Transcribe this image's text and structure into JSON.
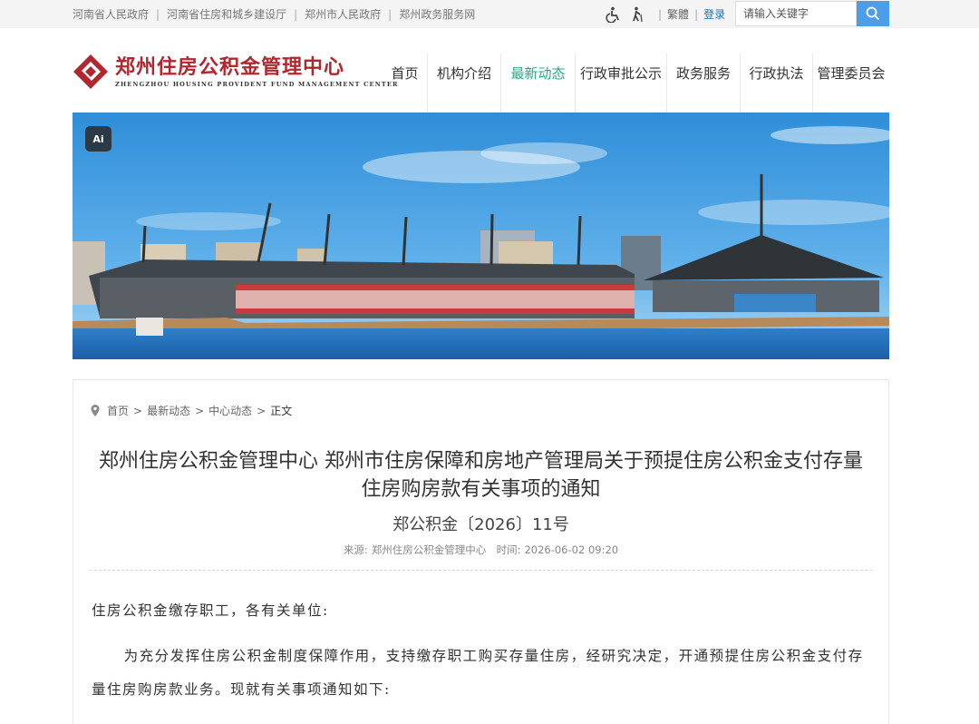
{
  "topbar": {
    "gov_links": [
      "河南省人民政府",
      "河南省住房和城乡建设厅",
      "郑州市人民政府",
      "郑州政务服务网"
    ],
    "icons": [
      "wheelchair-icon",
      "elderly-icon"
    ],
    "traditional_label": "繁體",
    "login_label": "登录",
    "search_placeholder": "请输入关键字"
  },
  "header": {
    "logo_cn": "郑州住房公积金管理中心",
    "logo_en": "ZHENGZHOU HOUSING PROVIDENT FUND MANAGEMENT CENTER",
    "nav": [
      "首页",
      "机构介绍",
      "最新动态",
      "行政审批公示",
      "政务服务",
      "行政执法",
      "管理委员会"
    ],
    "active_nav_index": 2
  },
  "banner": {
    "ai_badge": "Ai"
  },
  "article": {
    "breadcrumb": [
      "首页",
      "最新动态",
      "中心动态",
      "正文"
    ],
    "title": "郑州住房公积金管理中心 郑州市住房保障和房地产管理局关于预提住房公积金支付存量住房购房款有关事项的通知",
    "doc_number": "郑公积金〔2026〕11号",
    "source_label": "来源:",
    "source": "郑州住房公积金管理中心",
    "time_label": "时间:",
    "time": "2026-06-02 09:20",
    "salutation": "住房公积金缴存职工，各有关单位:",
    "paragraph1": "为充分发挥住房公积金制度保障作用，支持缴存职工购买存量住房，经研究决定，开通预提住房公积金支付存量住房购房款业务。现就有关事项通知如下:"
  },
  "colors": {
    "brand_red": "#b0282f",
    "nav_active": "#2aa58a",
    "link_blue": "#1f6fb5",
    "search_button": "#4d9ee8"
  }
}
